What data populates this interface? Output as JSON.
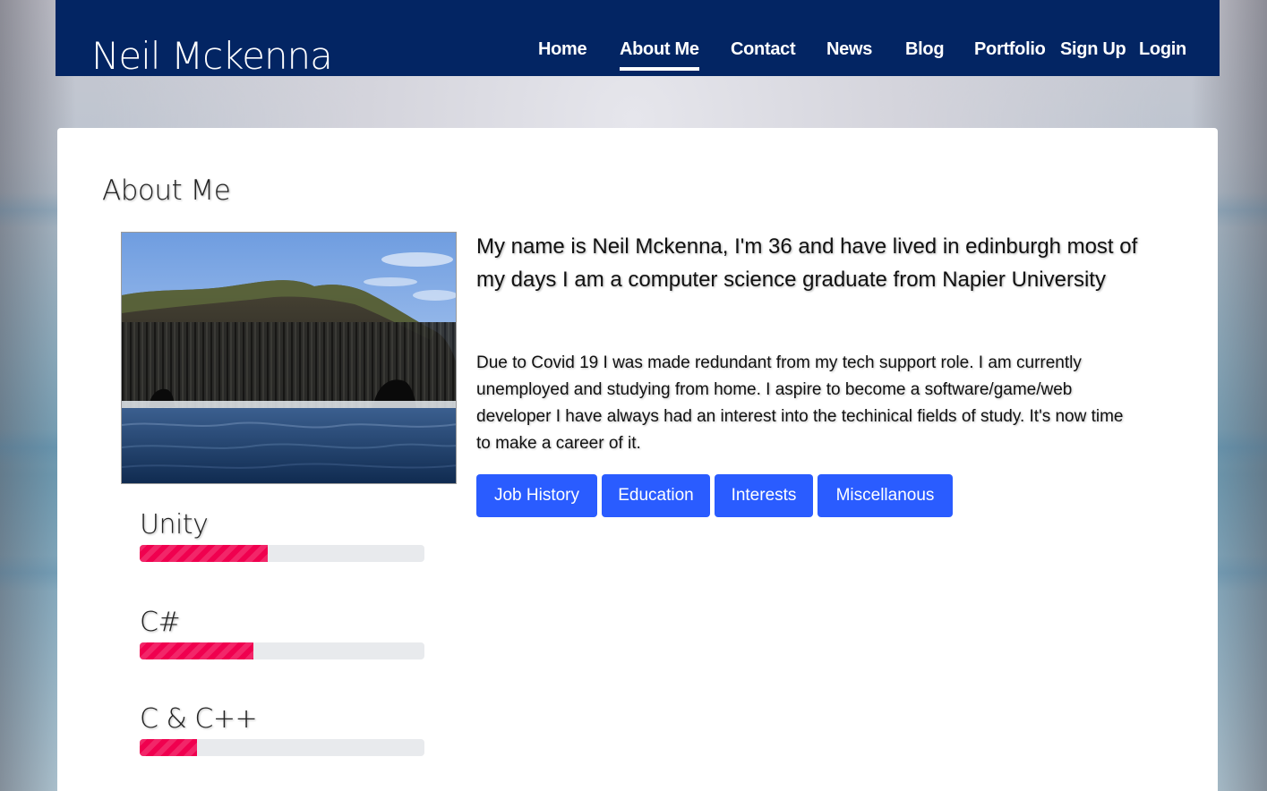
{
  "header": {
    "brand": "Neil Mckenna",
    "nav": [
      {
        "label": "Home",
        "active": false
      },
      {
        "label": "About Me",
        "active": true
      },
      {
        "label": "Contact",
        "active": false
      },
      {
        "label": "News",
        "active": false
      },
      {
        "label": "Blog",
        "active": false
      },
      {
        "label": "Portfolio",
        "active": false
      },
      {
        "label": "Sign Up",
        "active": false
      },
      {
        "label": "Login",
        "active": false
      }
    ]
  },
  "main": {
    "title": "About Me",
    "photo_icon": "sea-cave-cliff-photo",
    "intro": "My name is Neil Mckenna, I'm 36 and have lived in edinburgh most of my days I am a computer science graduate from Napier University",
    "description": "Due to Covid 19 I was made redundant from my tech support role. I am currently unemployed and studying from home. I aspire to become a software/game/web developer I have always had an interest into the techinical fields of study. It's now time to make a career of it.",
    "buttons": [
      "Job History",
      "Education",
      "Interests",
      "Miscellanous"
    ],
    "skills": [
      {
        "name": "Unity",
        "progress": 0.45
      },
      {
        "name": "C#",
        "progress": 0.4
      },
      {
        "name": "C & C++",
        "progress": 0.2
      }
    ]
  },
  "colors": {
    "navbar": "#032563",
    "button": "#2a5cff",
    "progress_fill": "#f0004f",
    "progress_track": "#e8eaed"
  }
}
